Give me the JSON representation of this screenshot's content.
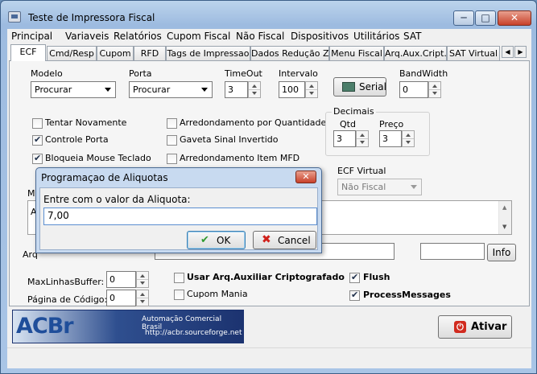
{
  "window": {
    "title": "Teste de Impressora Fiscal",
    "min": "─",
    "max": "□",
    "close": "✕"
  },
  "menu": [
    "Principal",
    "Variaveis",
    "Relatórios",
    "Cupom Fiscal",
    "Não Fiscal",
    "Dispositivos",
    "Utilitários",
    "SAT"
  ],
  "tabs": [
    "ECF",
    "Cmd/Resp",
    "Cupom",
    "RFD",
    "Tags de Impressao",
    "Dados Redução Z",
    "Menu Fiscal",
    "Arq.Aux.Cript.",
    "SAT Virtual"
  ],
  "tab_scroll": {
    "left": "◀",
    "right": "▶"
  },
  "fields": {
    "modelo_label": "Modelo",
    "modelo_value": "Procurar",
    "porta_label": "Porta",
    "porta_value": "Procurar",
    "timeout_label": "TimeOut",
    "timeout_value": "3",
    "intervalo_label": "Intervalo",
    "intervalo_value": "100",
    "serial_button": "Serial",
    "bandwidth_label": "BandWidth",
    "bandwidth_value": "0"
  },
  "checks_left": [
    {
      "label": "Tentar Novamente",
      "checked": false
    },
    {
      "label": "Controle Porta",
      "checked": true
    },
    {
      "label": "Bloqueia Mouse Teclado",
      "checked": true
    }
  ],
  "checks_mid": [
    {
      "label": "Arredondamento por Quantidade",
      "checked": false
    },
    {
      "label": "Gaveta Sinal Invertido",
      "checked": false
    },
    {
      "label": "Arredondamento Item MFD",
      "checked": false
    }
  ],
  "decimais": {
    "title": "Decimais",
    "qtd_label": "Qtd",
    "qtd_value": "3",
    "preco_label": "Preço",
    "preco_value": "3"
  },
  "ecf_virtual": {
    "label": "ECF Virtual",
    "value": "Não Fiscal"
  },
  "partial_labels": {
    "m": "M",
    "a": "A",
    "arq": "Arq"
  },
  "info_button": "Info",
  "bottom": {
    "maxlinhas_label": "MaxLinhasBuffer:",
    "maxlinhas_value": "0",
    "pagina_label": "Página de Código:",
    "pagina_value": "0",
    "usar_arq_label": "Usar Arq.Auxiliar Criptografado",
    "usar_arq_checked": false,
    "cupom_mania_label": "Cupom Mania",
    "cupom_mania_checked": false,
    "flush_label": "Flush",
    "flush_checked": true,
    "process_label": "ProcessMessages",
    "process_checked": true
  },
  "banner": {
    "logo": "ACBr",
    "text": "Automação Comercial Brasil",
    "url": "http://acbr.sourceforge.net"
  },
  "ativar_button": "Ativar",
  "dialog": {
    "title": "Programaçao de Aliquotas",
    "close": "✕",
    "prompt": "Entre com o valor da Aliquota:",
    "value": "7,00",
    "ok": "OK",
    "cancel": "Cancel"
  }
}
